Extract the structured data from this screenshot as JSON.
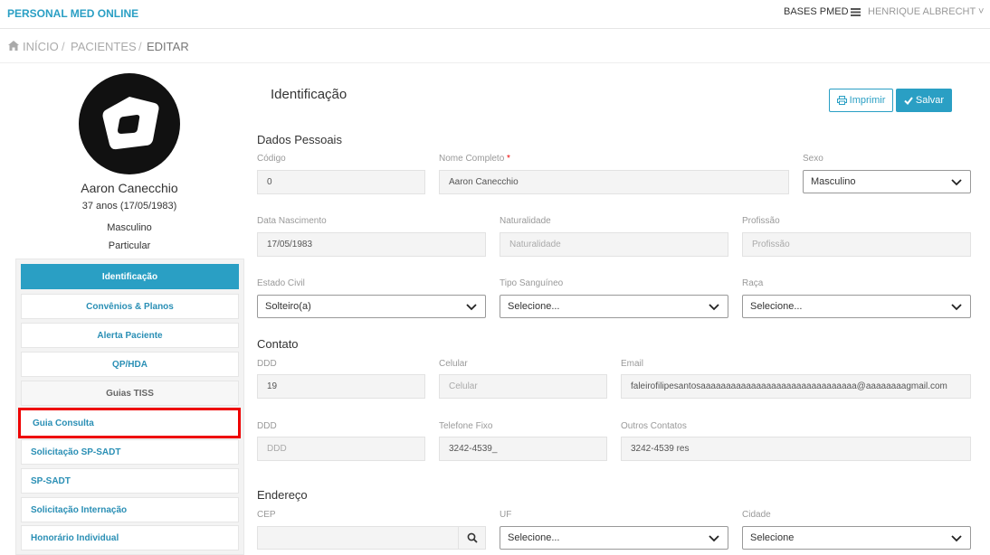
{
  "topbar": {
    "brand": "PERSONAL MED ONLINE",
    "bases": "BASES PMED",
    "user": "HENRIQUE ALBRECHT ˅"
  },
  "breadcrumb": {
    "home": "INÍCIO",
    "sep": "/",
    "patients": "PACIENTES",
    "current": "EDITAR"
  },
  "patient": {
    "name": "Aaron Canecchio",
    "age": "37 anos (17/05/1983)",
    "sex": "Masculino",
    "plan": "Particular"
  },
  "nav": [
    "Identificação",
    "Convênios & Planos",
    "Alerta Paciente",
    "QP/HDA",
    "Guias TISS",
    "Guia Consulta",
    "Solicitação SP-SADT",
    "SP-SADT",
    "Solicitação Internação",
    "Honorário Individual"
  ],
  "main": {
    "title": "Identificação",
    "print_label": "Imprimir",
    "save_label": "Salvar",
    "personal": {
      "heading": "Dados Pessoais",
      "codigo_label": "Código",
      "codigo": "0",
      "nome_label": "Nome Completo",
      "req": "*",
      "nome": "Aaron Canecchio",
      "sexo_label": "Sexo",
      "sexo": "Masculino",
      "nasc_label": "Data Nascimento",
      "nasc": "17/05/1983",
      "nat_label": "Naturalidade",
      "nat_ph": "Naturalidade",
      "prof_label": "Profissão",
      "prof_ph": "Profissão",
      "civil_label": "Estado Civil",
      "civil": "Solteiro(a)",
      "sangue_label": "Tipo Sanguíneo",
      "sangue": "Selecione...",
      "raca_label": "Raça",
      "raca": "Selecione..."
    },
    "contact": {
      "heading": "Contato",
      "ddd_label": "DDD",
      "ddd": "19",
      "cel_label": "Celular",
      "cel_ph": "Celular",
      "email_label": "Email",
      "email": "faleirofilipesantosaaaaaaaaaaaaaaaaaaaaaaaaaaaaaaa@aaaaaaaagmail.com",
      "ddd2_label": "DDD",
      "ddd2_ph": "DDD",
      "fixo_label": "Telefone Fixo",
      "fixo": "3242-4539_",
      "outros_label": "Outros Contatos",
      "outros": "3242-4539 res"
    },
    "address": {
      "heading": "Endereço",
      "cep_label": "CEP",
      "cep": "",
      "uf_label": "UF",
      "uf": "Selecione...",
      "cidade_label": "Cidade",
      "cidade": "Selecione"
    }
  },
  "colors": {
    "accent": "#2a9fc4",
    "highlight": "#e00000"
  }
}
